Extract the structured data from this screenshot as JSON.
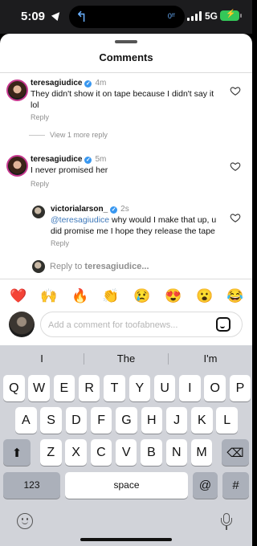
{
  "status_bar": {
    "time": "5:09",
    "vpn_label": "0ᶠᶠ",
    "network": "5G",
    "battery_label": "⚡"
  },
  "sheet": {
    "title": "Comments"
  },
  "comments": [
    {
      "username": "teresagiudice",
      "time": "4m",
      "text": "They didn't show it on tape because I didn't say it lol",
      "reply_label": "Reply",
      "view_more": "View 1 more reply"
    },
    {
      "username": "teresagiudice",
      "time": "5m",
      "text": "I never promised her",
      "reply_label": "Reply"
    }
  ],
  "nested_reply": {
    "username": "victorialarson_",
    "time": "2s",
    "mention": "@teresagiudice",
    "text": " why would I make that up, u did promise me I hope they release the tape",
    "reply_label": "Reply"
  },
  "reply_to": {
    "prefix": "Reply to ",
    "username": "teresagiudice..."
  },
  "emoji_bar": [
    "❤️",
    "🙌",
    "🔥",
    "👏",
    "😢",
    "😍",
    "😮",
    "😂"
  ],
  "comment_input": {
    "placeholder": "Add a comment for toofabnews..."
  },
  "keyboard": {
    "suggestions": [
      "I",
      "The",
      "I'm"
    ],
    "row1": [
      "Q",
      "W",
      "E",
      "R",
      "T",
      "Y",
      "U",
      "I",
      "O",
      "P"
    ],
    "row2": [
      "A",
      "S",
      "D",
      "F",
      "G",
      "H",
      "J",
      "K",
      "L"
    ],
    "row3": [
      "Z",
      "X",
      "C",
      "V",
      "B",
      "N",
      "M"
    ],
    "numbers_key": "123",
    "space_key": "space",
    "at_key": "@",
    "hash_key": "#"
  },
  "colors": {
    "accent": "#3897f0",
    "mention": "#3f79ba",
    "battery": "#34c759",
    "story_ring": "#c7398f"
  }
}
